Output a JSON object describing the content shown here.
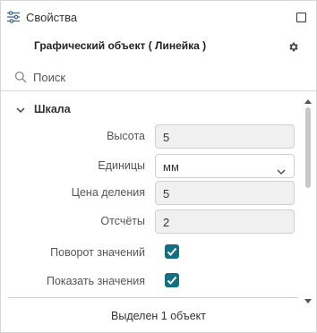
{
  "header": {
    "title": "Свойства",
    "settings_icon": "sliders-icon",
    "window_icon": "maximize-icon"
  },
  "object": {
    "title": "Графический объект ( Линейка )",
    "action_icon": "gear-icon"
  },
  "search": {
    "placeholder": "Поиск",
    "value": ""
  },
  "section": {
    "title": "Шкала",
    "expanded": true
  },
  "fields": {
    "height": {
      "label": "Высота",
      "value": "5"
    },
    "units": {
      "label": "Единицы",
      "value": "мм"
    },
    "division": {
      "label": "Цена деления",
      "value": "5"
    },
    "ticks": {
      "label": "Отсчёты",
      "value": "2"
    },
    "rotate_values": {
      "label": "Поворот значений",
      "checked": true
    },
    "show_values": {
      "label": "Показать значения",
      "checked": true
    }
  },
  "status": {
    "text": "Выделен 1 объект"
  },
  "colors": {
    "accent": "#14707f",
    "border": "#cfcfcf",
    "field_bg": "#f0f0f0"
  }
}
